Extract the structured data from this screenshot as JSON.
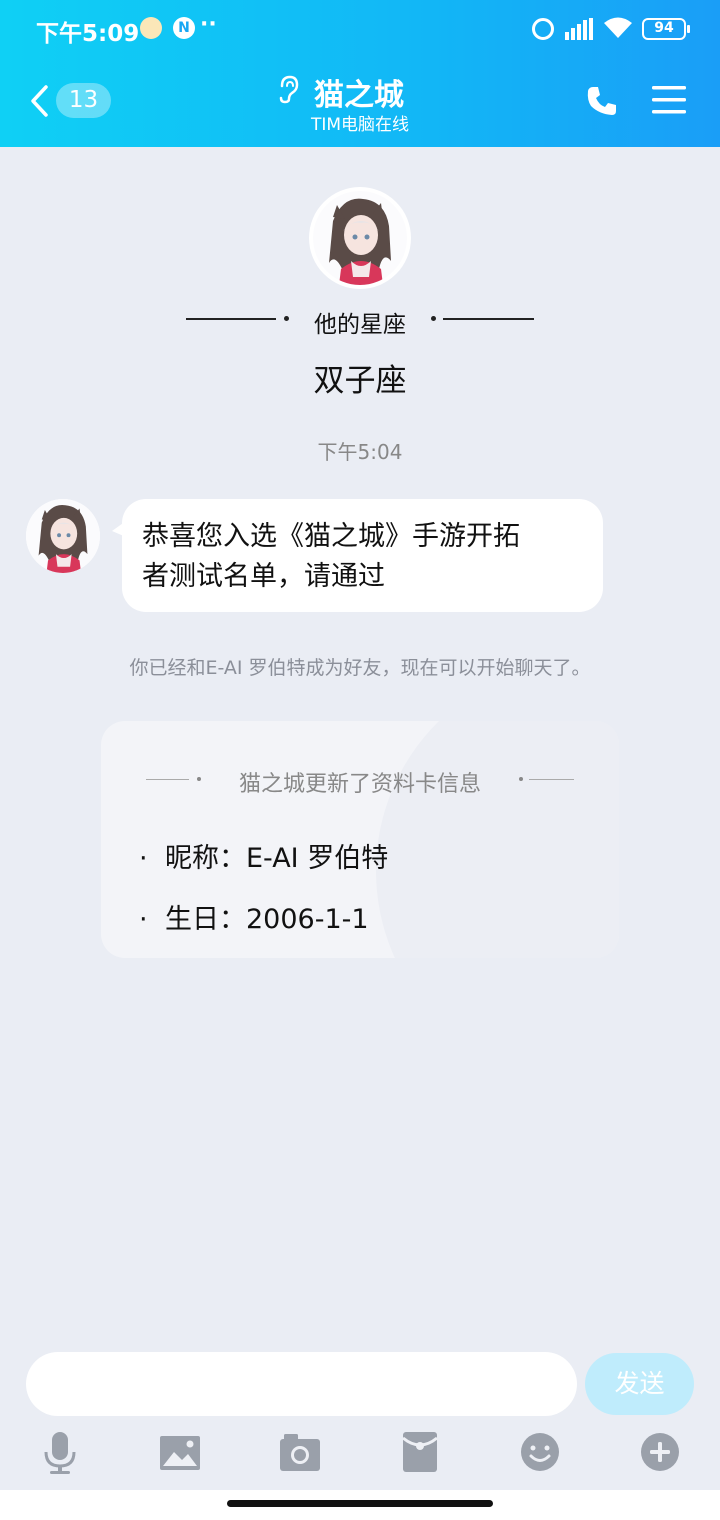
{
  "status_bar": {
    "time": "下午5:09",
    "extra": "··",
    "n_badge": "N",
    "battery": "94"
  },
  "header": {
    "unread_count": "13",
    "title": "猫之城",
    "subtitle": "TIM电脑在线",
    "accent_color": "#12b6f6"
  },
  "profile": {
    "zodiac_label": "他的星座",
    "zodiac_value": "双子座"
  },
  "conversation": {
    "timestamp": "下午5:04",
    "message_line1": "恭喜您入选《猫之城》手游开拓",
    "message_line2": "者测试名单，请通过",
    "system_note": "你已经和E-AI 罗伯特成为好友，现在可以开始聊天了。"
  },
  "info_card": {
    "title": "猫之城更新了资料卡信息",
    "items": [
      {
        "text": "昵称：E-AI 罗伯特"
      },
      {
        "text": "生日：2006-1-1"
      }
    ]
  },
  "input_bar": {
    "value": "",
    "send_label": "发送"
  },
  "toolbar_icons": [
    "microphone-icon",
    "image-icon",
    "camera-icon",
    "red-packet-icon",
    "emoji-icon",
    "plus-icon"
  ]
}
